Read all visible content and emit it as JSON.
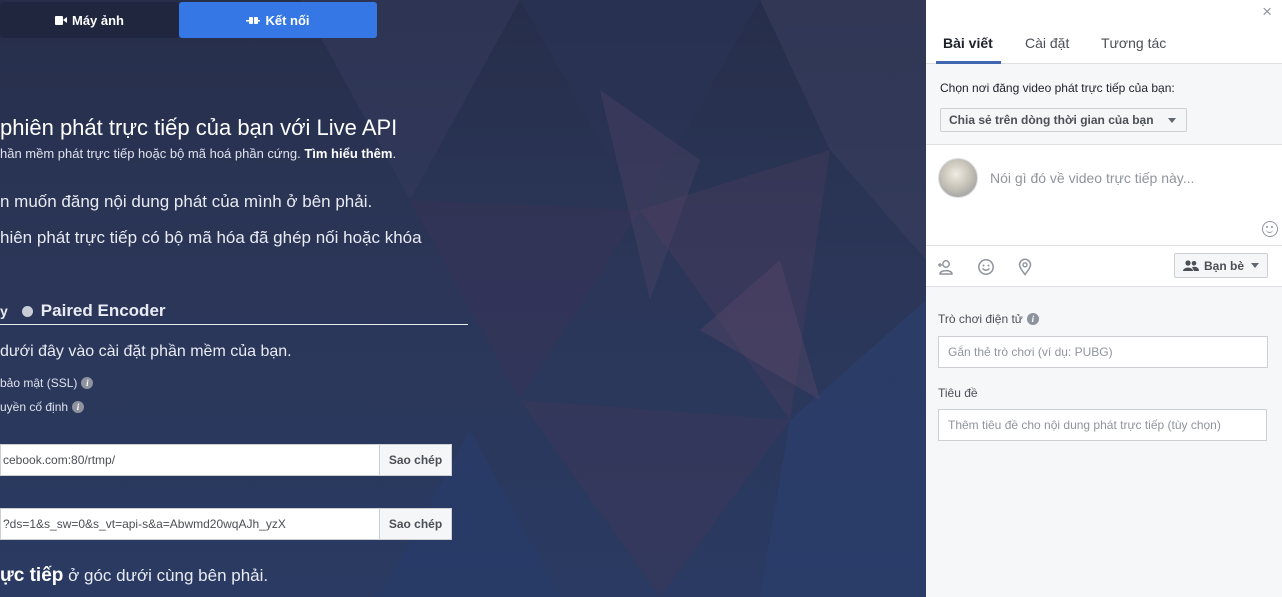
{
  "left": {
    "tabs": [
      {
        "label": "Máy ảnh",
        "icon": "camera-icon"
      },
      {
        "label": "Kết nối",
        "icon": "connect-icon"
      }
    ],
    "accent_color": "#3578e5",
    "heading": "phiên phát trực tiếp của bạn với Live API",
    "subheading": "hần mềm phát trực tiếp hoặc bộ mã hoá phần cứng.",
    "learn_more": "Tìm hiểu thêm",
    "subheading_end": ".",
    "para1": "n muốn đăng nội dung phát của mình ở bên phải.",
    "para2": "hiên phát trực tiếp có bộ mã hóa đã ghép nối hoặc khóa",
    "mode_prefix": "y",
    "mode_label": "Paired Encoder",
    "para3": "dưới đây vào cài đặt phần mềm của bạn.",
    "option_ssl": "bảo mật (SSL)",
    "option_fixed": "uyền cố định",
    "server_url": "cebook.com:80/rtmp/",
    "stream_key": "?ds=1&s_sw=0&s_vt=api-s&a=Abwmd20wqAJh_yzX",
    "copy_label": "Sao chép",
    "bottom_bold": "ực tiếp",
    "bottom_rest": " ở góc dưới cùng bên phải."
  },
  "right": {
    "close": "×",
    "tabs": [
      {
        "label": "Bài viết",
        "active": true
      },
      {
        "label": "Cài đặt",
        "active": false
      },
      {
        "label": "Tương tác",
        "active": false
      }
    ],
    "share_label": "Chọn nơi đăng video phát trực tiếp của bạn:",
    "share_select": "Chia sẻ trên dòng thời gian của bạn",
    "composer_placeholder": "Nói gì đó về video trực tiếp này...",
    "audience": "Bạn bè",
    "game_label": "Trò chơi điện tử",
    "game_placeholder": "Gắn thẻ trò chơi (ví dụ: PUBG)",
    "title_label": "Tiêu đề",
    "title_placeholder": "Thêm tiêu đề cho nội dung phát trực tiếp (tùy chọn)",
    "tab_underline_color": "#4267b2"
  }
}
